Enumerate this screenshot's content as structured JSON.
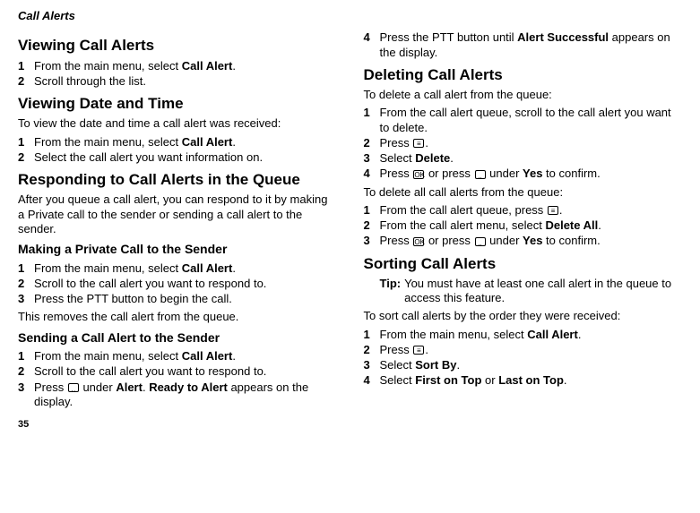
{
  "header": "Call Alerts",
  "page_num": "35",
  "left": {
    "h2_1": "Viewing Call Alerts",
    "s1_1": "From the main menu, select ",
    "s1_1b": "Call Alert",
    "s1_1c": ".",
    "s1_2": "Scroll through the list.",
    "h2_2": "Viewing Date and Time",
    "p1": "To view the date and time a call alert was received:",
    "s2_1": "From the main menu, select ",
    "s2_1b": "Call Alert",
    "s2_1c": ".",
    "s2_2": "Select the call alert you want information on.",
    "h2_3": "Responding to Call Alerts in the Queue",
    "p2": "After you queue a call alert, you can respond to it by making a Private call to the sender or sending a call alert to the sender.",
    "h3_1": "Making a Private Call to the Sender",
    "s3_1": "From the main menu, select ",
    "s3_1b": "Call Alert",
    "s3_1c": ".",
    "s3_2": "Scroll to the call alert you want to respond to.",
    "s3_3": "Press the PTT button to begin the call.",
    "p3": "This removes the call alert from the queue.",
    "h3_2": "Sending a Call Alert to the Sender",
    "s4_1": "From the main menu, select ",
    "s4_1b": "Call Alert",
    "s4_1c": ".",
    "s4_2": "Scroll to the call alert you want to respond to.",
    "s4_3a": "Press ",
    "s4_3b": " under ",
    "s4_3c": "Alert",
    "s4_3d": ". ",
    "s4_3e": "Ready to Alert",
    "s4_3f": " appears on the display."
  },
  "right": {
    "s5_4a": "Press the PTT button until ",
    "s5_4b": "Alert Successful",
    "s5_4c": " appears on the display.",
    "h2_4": "Deleting Call Alerts",
    "p4": "To delete a call alert from the queue:",
    "s6_1": "From the call alert queue, scroll to the call alert you want to delete.",
    "s6_2a": "Press ",
    "s6_2b": ".",
    "s6_3a": "Select ",
    "s6_3b": "Delete",
    "s6_3c": ".",
    "s6_4a": "Press ",
    "s6_4b": " or press ",
    "s6_4c": " under ",
    "s6_4d": "Yes",
    "s6_4e": " to confirm.",
    "p5": "To delete all call alerts from the queue:",
    "s7_1a": "From the call alert queue, press ",
    "s7_1b": ".",
    "s7_2a": "From the call alert menu, select ",
    "s7_2b": "Delete All",
    "s7_2c": ".",
    "s7_3a": "Press ",
    "s7_3b": " or press ",
    "s7_3c": " under ",
    "s7_3d": "Yes",
    "s7_3e": " to confirm.",
    "h2_5": "Sorting Call Alerts",
    "tip_label": "Tip:",
    "tip_text": "You must have at least one call alert in the queue to access this feature.",
    "p6": "To sort call alerts by the order they were received:",
    "s8_1a": "From the main menu, select ",
    "s8_1b": "Call Alert",
    "s8_1c": ".",
    "s8_2a": "Press ",
    "s8_2b": ".",
    "s8_3a": "Select ",
    "s8_3b": "Sort By",
    "s8_3c": ".",
    "s8_4a": "Select ",
    "s8_4b": "First on Top",
    "s8_4c": " or ",
    "s8_4d": "Last on Top",
    "s8_4e": "."
  },
  "icons": {
    "menu": "≡",
    "ok": "OK",
    "soft": "�band"
  }
}
